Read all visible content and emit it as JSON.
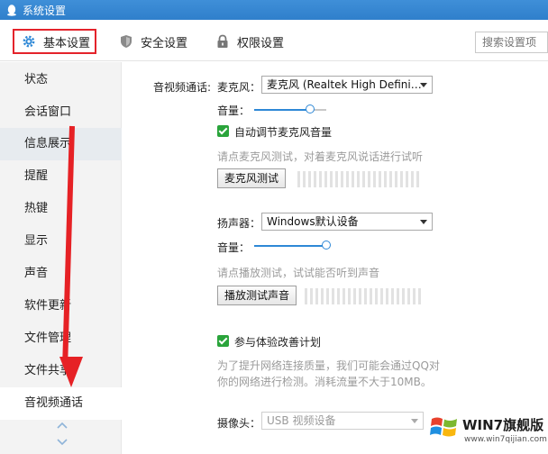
{
  "window": {
    "title": "系统设置"
  },
  "tabs": {
    "basic": "基本设置",
    "security": "安全设置",
    "permission": "权限设置"
  },
  "search": {
    "placeholder": "搜索设置项"
  },
  "sidebar": {
    "items": [
      {
        "label": "状态"
      },
      {
        "label": "会话窗口"
      },
      {
        "label": "信息展示"
      },
      {
        "label": "提醒"
      },
      {
        "label": "热键"
      },
      {
        "label": "显示"
      },
      {
        "label": "声音"
      },
      {
        "label": "软件更新"
      },
      {
        "label": "文件管理"
      },
      {
        "label": "文件共享"
      },
      {
        "label": "音视频通话"
      }
    ],
    "active": "音视频通话"
  },
  "av": {
    "section_label": "音视频通话:",
    "mic_label": "麦克风：",
    "mic_device": "麦克风 (Realtek High Defini…",
    "volume_label": "音量：",
    "mic_volume": 0.78,
    "auto_adjust_label": "自动调节麦克风音量",
    "auto_adjust_checked": true,
    "mic_hint": "请点麦克风测试，对着麦克风说话进行试听",
    "mic_test_button": "麦克风测试",
    "speaker_label": "扬声器：",
    "speaker_device": "Windows默认设备",
    "speaker_volume": 1.0,
    "speaker_hint": "请点播放测试，试试能否听到声音",
    "speaker_test_button": "播放测试声音",
    "improve_label": "参与体验改善计划",
    "improve_checked": true,
    "improve_desc_1": "为了提升网络连接质量，我们可能会通过QQ对",
    "improve_desc_2": "你的网络进行检测。消耗流量不大于10MB。",
    "camera_label": "摄像头：",
    "camera_device": "USB 视频设备"
  },
  "watermark": {
    "brand": "WIN7旗舰版",
    "url": "www.win7qijian.com"
  },
  "colors": {
    "titlebar": "#2f7fcb",
    "accent": "#2e88d6",
    "annotation": "#e62125",
    "check": "#2aa43b"
  }
}
